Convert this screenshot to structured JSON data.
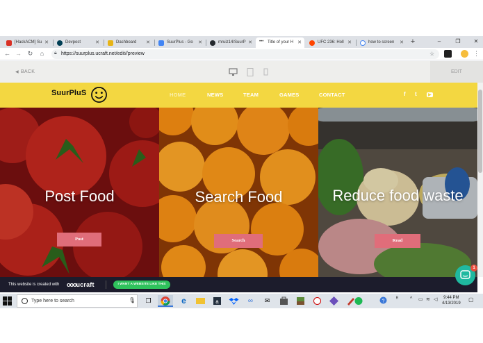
{
  "browser": {
    "tabs": [
      {
        "label": "[HackACM] Su",
        "favicon_color": "#d93025"
      },
      {
        "label": "Devpost",
        "favicon_color": "#003e54"
      },
      {
        "label": "Dashboard",
        "favicon_color": "#e7b416"
      },
      {
        "label": "SuurPlus - Go",
        "favicon_color": "#4285f4"
      },
      {
        "label": "mruiz14/SuurP",
        "favicon_color": "#24292e"
      },
      {
        "label": "Title of your H",
        "favicon_color": "#333333"
      },
      {
        "label": "UFC 236: Holl",
        "favicon_color": "#ff4500"
      },
      {
        "label": "how to screen",
        "favicon_color": "#4285f4"
      }
    ],
    "new_tab_label": "+",
    "window_controls": {
      "minimize": "–",
      "restore": "❐",
      "close": "✕"
    },
    "url": "https://suurplus.ucraft.net/edit//preview"
  },
  "editor": {
    "back_label": "BACK",
    "edit_label": "EDIT"
  },
  "site": {
    "logo_text": "SuurPluS",
    "nav": [
      "HOME",
      "NEWS",
      "TEAM",
      "GAMES",
      "CONTACT"
    ],
    "social": {
      "facebook": "f",
      "twitter": "t",
      "youtube": "▶"
    },
    "panels": [
      {
        "title": "Post Food",
        "button": "Post"
      },
      {
        "title": "Search Food",
        "button": "Search"
      },
      {
        "title": "Reduce food waste",
        "button": "Read"
      }
    ]
  },
  "footer": {
    "made_with": "This website is created with",
    "brand": "ucraft",
    "cta": "I WANT A WEBSITE LIKE THIS",
    "chat_badge": "1"
  },
  "taskbar": {
    "search_placeholder": "Type here to search",
    "time": "9:44 PM",
    "date": "4/13/2019"
  },
  "colors": {
    "site_yellow": "#f3d741",
    "button_pink": "#e06d7a",
    "footer_dark": "#1c1c2c",
    "cta_green": "#2fc25c",
    "chat_teal": "#1fb9a0"
  }
}
